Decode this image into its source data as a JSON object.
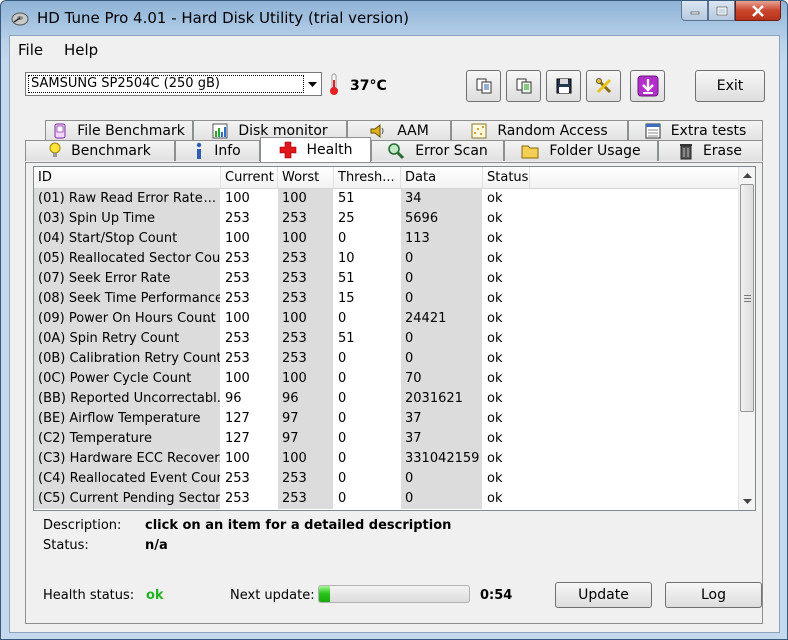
{
  "window": {
    "title": "HD Tune Pro 4.01 - Hard Disk Utility (trial version)"
  },
  "menu": {
    "file": "File",
    "help": "Help"
  },
  "toolbar": {
    "drive": "SAMSUNG SP2504C (250 gB)",
    "temperature": "37°C",
    "exit_label": "Exit"
  },
  "tabs_top": [
    {
      "label": "File Benchmark",
      "icon": "phone-icon"
    },
    {
      "label": "Disk monitor",
      "icon": "bar-chart-icon"
    },
    {
      "label": "AAM",
      "icon": "speaker-icon"
    },
    {
      "label": "Random Access",
      "icon": "scatter-icon"
    },
    {
      "label": "Extra tests",
      "icon": "grid-window-icon"
    }
  ],
  "tabs_bottom": [
    {
      "label": "Benchmark",
      "icon": "lightbulb-icon"
    },
    {
      "label": "Info",
      "icon": "info-icon"
    },
    {
      "label": "Health",
      "icon": "red-cross-icon",
      "active": true
    },
    {
      "label": "Error Scan",
      "icon": "magnifier-icon"
    },
    {
      "label": "Folder Usage",
      "icon": "folder-icon"
    },
    {
      "label": "Erase",
      "icon": "trash-icon"
    }
  ],
  "table": {
    "headers": [
      "ID",
      "Current",
      "Worst",
      "Thresh...",
      "Data",
      "Status"
    ],
    "rows": [
      {
        "id": "(01) Raw Read Error Rate",
        "dots": "...",
        "current": "100",
        "worst": "100",
        "thresh": "51",
        "data": "34",
        "status": "ok"
      },
      {
        "id": "(03) Spin Up Time",
        "dots": "",
        "current": "253",
        "worst": "253",
        "thresh": "25",
        "data": "5696",
        "status": "ok"
      },
      {
        "id": "(04) Start/Stop Count",
        "dots": "",
        "current": "100",
        "worst": "100",
        "thresh": "0",
        "data": "113",
        "status": "ok"
      },
      {
        "id": "(05) Reallocated Sector Cou...",
        "dots": "",
        "current": "253",
        "worst": "253",
        "thresh": "10",
        "data": "0",
        "status": "ok"
      },
      {
        "id": "(07) Seek Error Rate",
        "dots": "",
        "current": "253",
        "worst": "253",
        "thresh": "51",
        "data": "0",
        "status": "ok"
      },
      {
        "id": "(08) Seek Time Performance...",
        "dots": "",
        "current": "253",
        "worst": "253",
        "thresh": "15",
        "data": "0",
        "status": "ok"
      },
      {
        "id": "(09) Power On Hours Count",
        "dots": "...",
        "current": "100",
        "worst": "100",
        "thresh": "0",
        "data": "24421",
        "status": "ok"
      },
      {
        "id": "(0A) Spin Retry Count",
        "dots": "",
        "current": "253",
        "worst": "253",
        "thresh": "51",
        "data": "0",
        "status": "ok"
      },
      {
        "id": "(0B) Calibration Retry Count",
        "dots": "",
        "current": "253",
        "worst": "253",
        "thresh": "0",
        "data": "0",
        "status": "ok"
      },
      {
        "id": "(0C) Power Cycle Count",
        "dots": "",
        "current": "100",
        "worst": "100",
        "thresh": "0",
        "data": "70",
        "status": "ok"
      },
      {
        "id": "(BB) Reported Uncorrectabl...",
        "dots": "",
        "current": "96",
        "worst": "96",
        "thresh": "0",
        "data": "2031621",
        "status": "ok"
      },
      {
        "id": "(BE) Airflow Temperature",
        "dots": "",
        "current": "127",
        "worst": "97",
        "thresh": "0",
        "data": "37",
        "status": "ok"
      },
      {
        "id": "(C2) Temperature",
        "dots": "",
        "current": "127",
        "worst": "97",
        "thresh": "0",
        "data": "37",
        "status": "ok"
      },
      {
        "id": "(C3) Hardware ECC Recover...",
        "dots": "",
        "current": "100",
        "worst": "100",
        "thresh": "0",
        "data": "331042159",
        "status": "ok"
      },
      {
        "id": "(C4) Reallocated Event Coun...",
        "dots": "",
        "current": "253",
        "worst": "253",
        "thresh": "0",
        "data": "0",
        "status": "ok"
      },
      {
        "id": "(C5) Current Pending Sector",
        "dots": "...",
        "current": "253",
        "worst": "253",
        "thresh": "0",
        "data": "0",
        "status": "ok"
      }
    ]
  },
  "details": {
    "description_label": "Description:",
    "description_value": "click on an item for a detailed description",
    "status_label": "Status:",
    "status_value": "n/a"
  },
  "footer": {
    "health_label": "Health status:",
    "health_value": "ok",
    "health_color": "#22b322",
    "next_update_label": "Next update:",
    "progress_fraction": 0.07,
    "countdown": "0:54",
    "update_label": "Update",
    "log_label": "Log"
  }
}
